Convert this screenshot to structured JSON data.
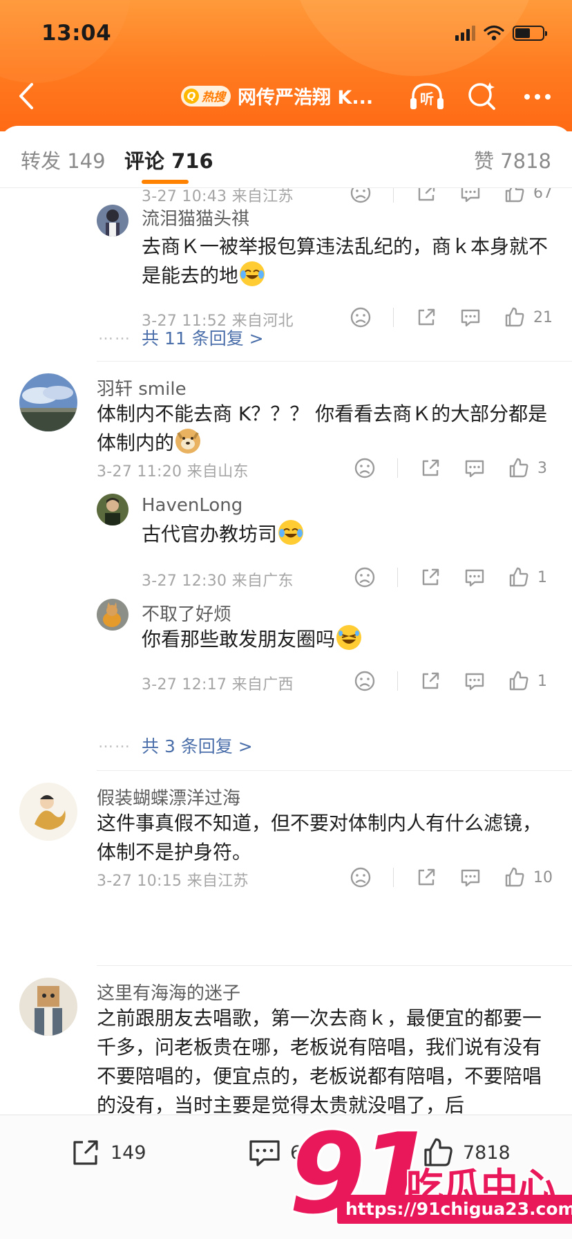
{
  "status": {
    "time": "13:04"
  },
  "header": {
    "hot_badge": "热搜",
    "title": "网传严浩翔 K...",
    "listen_label": "听"
  },
  "tabs": {
    "repost": "转发 149",
    "comments": "评论 716",
    "likes": "赞 7818"
  },
  "comments": [
    {
      "id": "c0_tail",
      "meta": "3-27 10:43  来自江苏",
      "likes": "67"
    },
    {
      "id": "r1",
      "user": "流泪猫猫头祺",
      "text": "去商Ｋ一被举报包算违法乱纪的，商ｋ本身就不是能去的地",
      "emoji": "laugh-cry",
      "meta": "3-27 11:52  来自河北",
      "likes": "21"
    },
    {
      "id": "more1",
      "more": "共 11 条回复 >"
    },
    {
      "id": "c2",
      "user": "羽轩 smile",
      "text": "体制内不能去商 K？？？ 你看看去商Ｋ的大部分都是体制内的",
      "emoji": "doge",
      "meta": "3-27 11:20  来自山东",
      "likes": "3"
    },
    {
      "id": "r2",
      "user": "HavenLong",
      "text": "古代官办教坊司",
      "emoji": "laugh-cry",
      "meta": "3-27 12:30  来自广东",
      "likes": "1"
    },
    {
      "id": "r3",
      "user": "不取了好烦",
      "text": "你看那些敢发朋友圈吗",
      "emoji": "laugh",
      "meta": "3-27 12:17  来自广西",
      "likes": "1"
    },
    {
      "id": "more2",
      "more": "共 3 条回复 >"
    },
    {
      "id": "c3",
      "user": "假装蝴蝶漂洋过海",
      "text": "这件事真假不知道，但不要对体制内人有什么滤镜，体制不是护身符。",
      "meta": "3-27 10:15  来自江苏",
      "likes": "10"
    },
    {
      "id": "c4",
      "user": "这里有海海的迷子",
      "text": "之前跟朋友去唱歌，第一次去商ｋ，最便宜的都要一千多，问老板贵在哪，老板说有陪唱，我们说有没有不要陪唱的，便宜点的，老板说都有陪唱，不要陪唱的没有，当时主要是觉得太贵就没唱了，后"
    }
  ],
  "bottom_bar": {
    "repost": "149",
    "comment": "6",
    "like": "7818"
  },
  "watermark": {
    "number": "91",
    "brand": "吃瓜中心",
    "url": "https://91chigua23.com"
  },
  "colors": {
    "accent_orange": "#ff8200",
    "link_blue": "#4a6ea9",
    "watermark_pink": "#e8185b"
  }
}
